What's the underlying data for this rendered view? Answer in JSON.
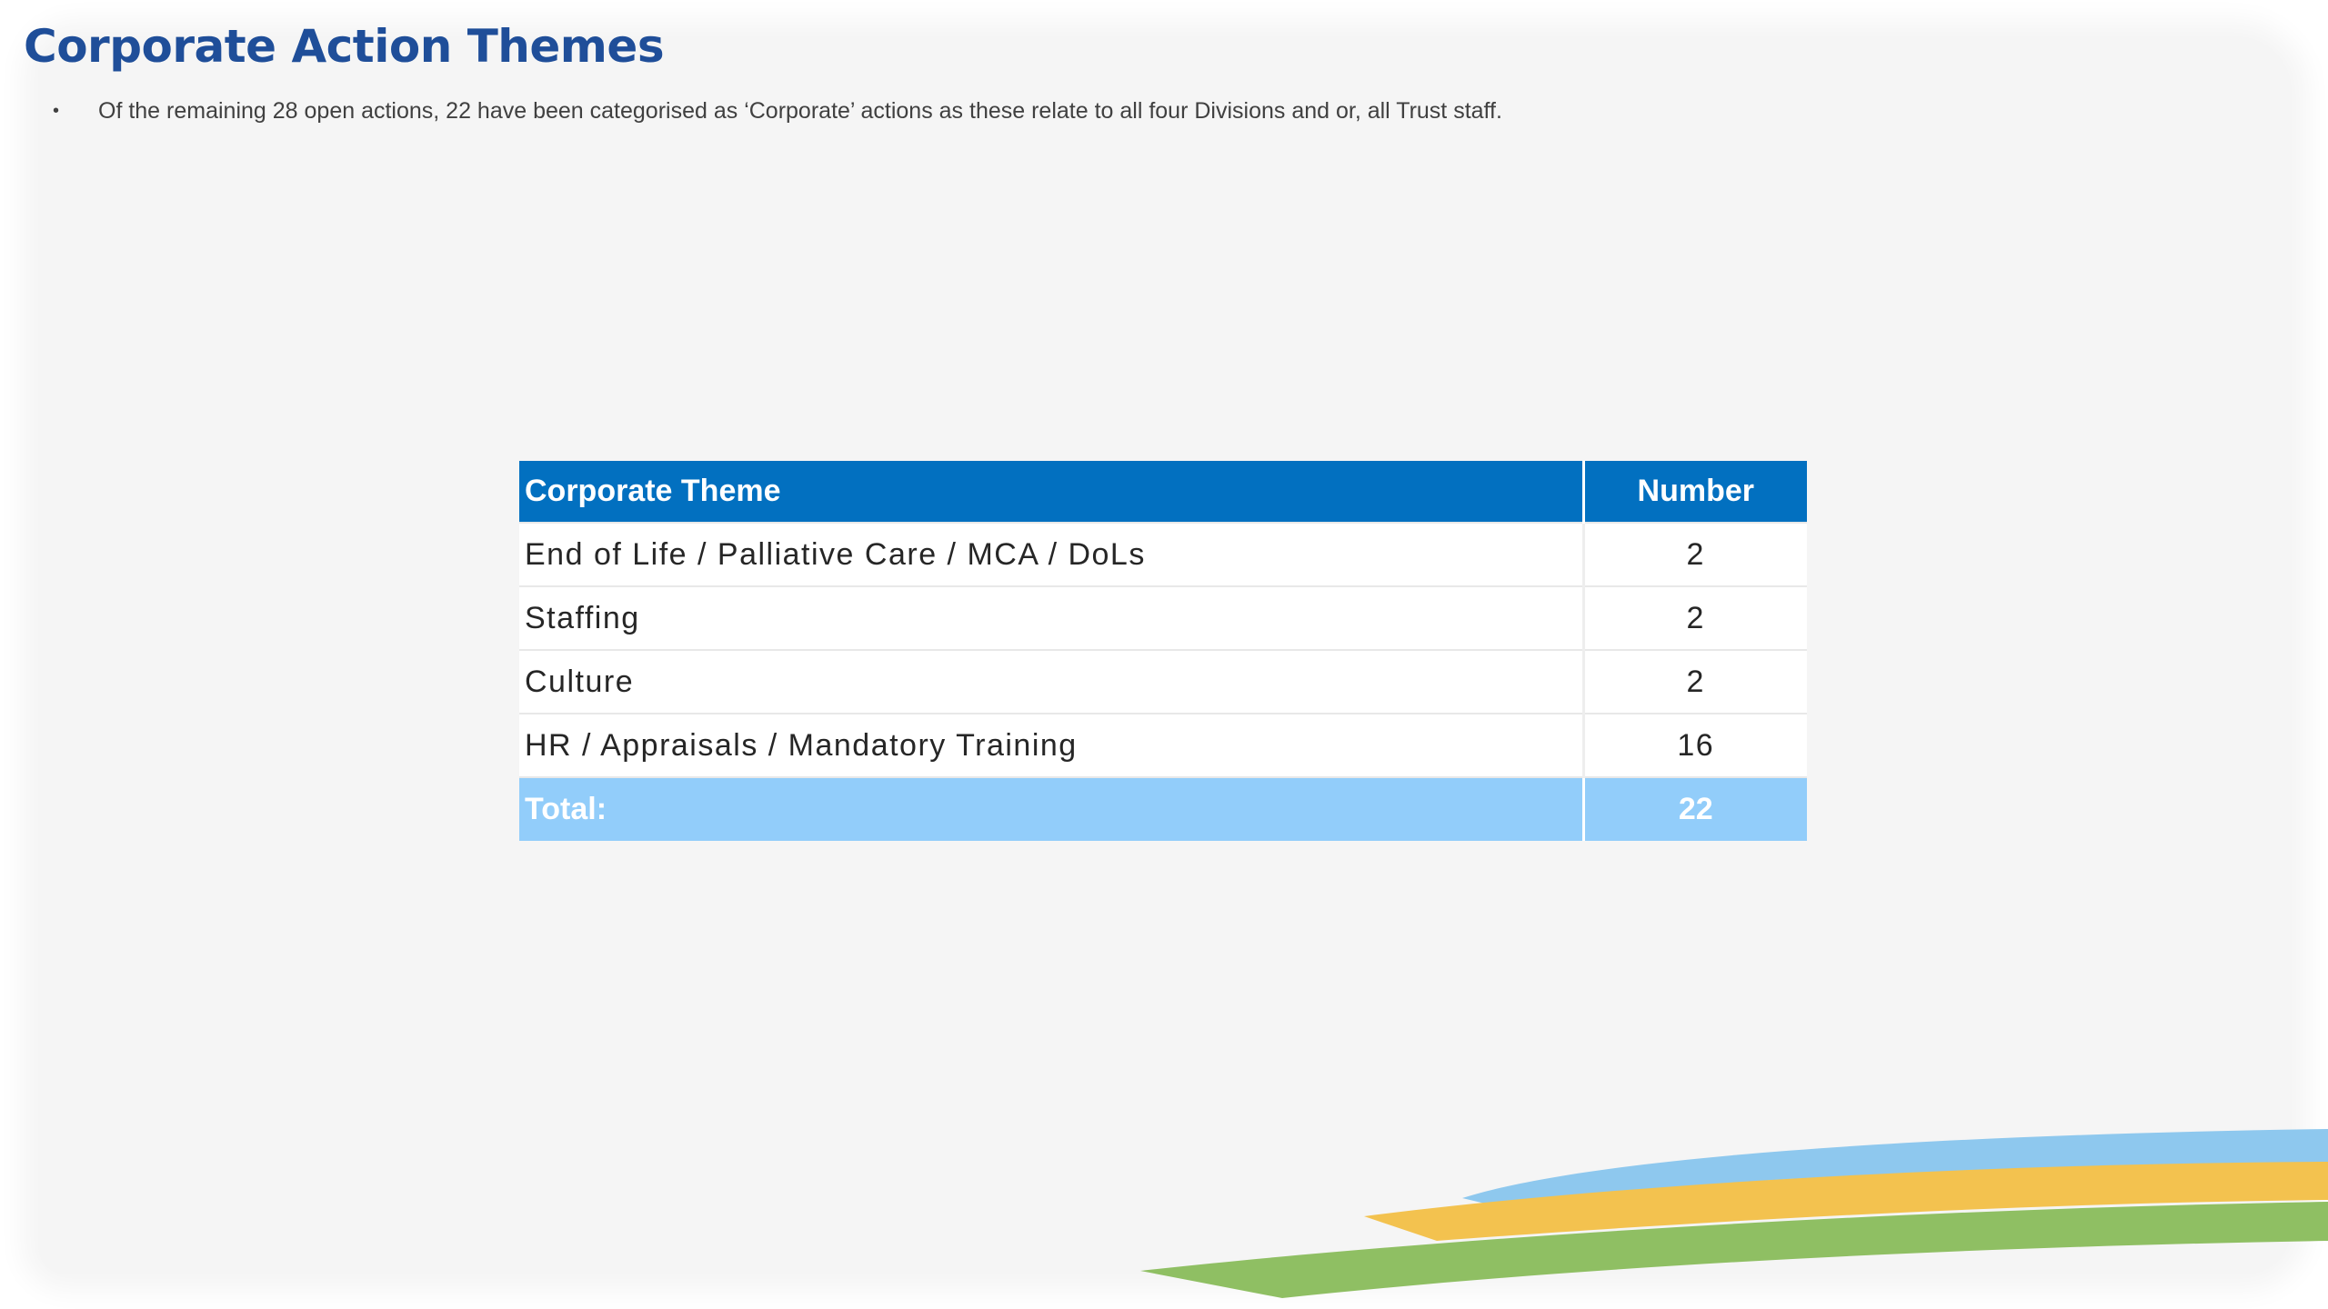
{
  "slide": {
    "title": "Corporate Action Themes",
    "bullet": "Of the remaining 28 open actions, 22 have been categorised as ‘Corporate’ actions as these relate to all four Divisions and or, all Trust staff."
  },
  "table": {
    "headers": {
      "theme": "Corporate Theme",
      "number": "Number"
    },
    "rows": [
      {
        "theme": "End of Life / Palliative Care / MCA / DoLs",
        "number": "2"
      },
      {
        "theme": "Staffing",
        "number": "2"
      },
      {
        "theme": "Culture",
        "number": "2"
      },
      {
        "theme": "HR / Appraisals / Mandatory Training",
        "number": "16"
      }
    ],
    "total": {
      "label": "Total:",
      "number": "22"
    }
  },
  "colors": {
    "title": "#1f4e99",
    "header_bg": "#0270c0",
    "total_bg": "#92cdfa",
    "swoosh_blue": "#8ec8ee",
    "swoosh_yellow": "#f3c24f",
    "swoosh_green": "#8fbf63"
  }
}
